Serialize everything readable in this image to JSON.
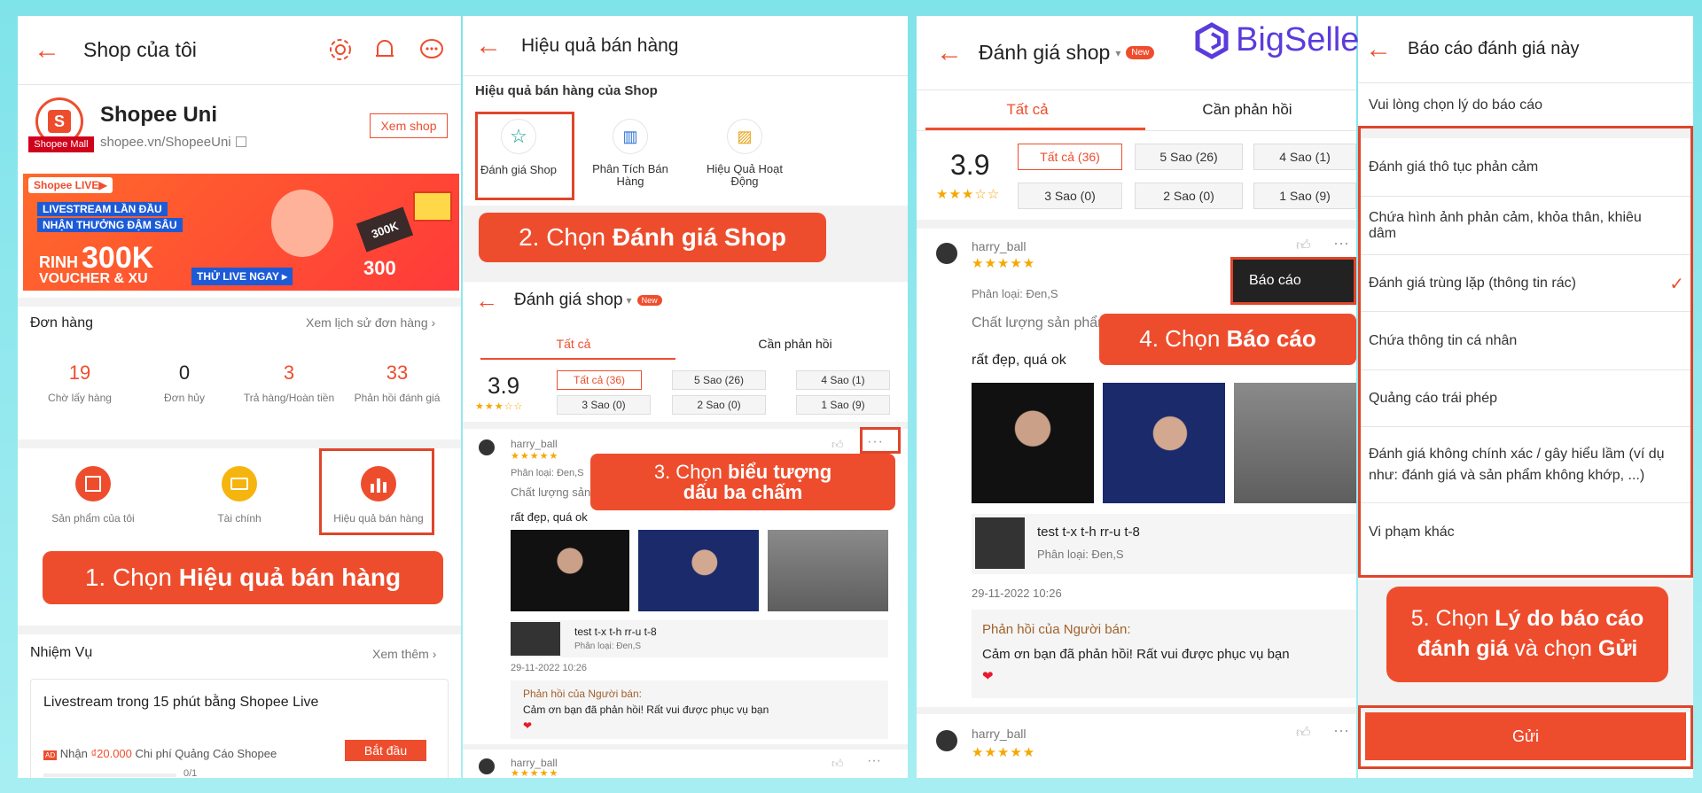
{
  "p1": {
    "title": "Shop của tôi",
    "shop_name": "Shopee Uni",
    "shop_url": "shopee.vn/ShopeeUni",
    "view_shop": "Xem shop",
    "mall_badge": "Shopee Mall",
    "banner": {
      "live_tag": "Shopee LIVE▶",
      "line1": "LIVESTREAM LẦN ĐẦU",
      "line2": "NHẬN THƯỞNG ĐẬM SÂU",
      "line3": "RINH",
      "amount": "300K",
      "line4": "VOUCHER & XU",
      "cta": "THỬ LIVE NGAY ▸",
      "coin1": "300K",
      "coin2": "300"
    },
    "orders": {
      "title": "Đơn hàng",
      "history": "Xem lịch sử đơn hàng",
      "stats": [
        {
          "v": "19",
          "l": "Chờ lấy hàng"
        },
        {
          "v": "0",
          "l": "Đơn hủy"
        },
        {
          "v": "3",
          "l": "Trả hàng/Hoàn tiền"
        },
        {
          "v": "33",
          "l": "Phản hồi đánh giá"
        }
      ]
    },
    "menu": [
      "Sản phẩm của tôi",
      "Tài chính",
      "Hiệu quả bán hàng"
    ],
    "callout_pre": "1. Chọn ",
    "callout_bold": "Hiệu quả bán hàng",
    "tasks": {
      "title": "Nhiệm Vụ",
      "more": "Xem thêm",
      "card_title": "Livestream trong 15 phút bằng Shopee Live",
      "reward_pre": "Nhận ",
      "reward_amt": "₫20.000",
      "reward_post": " Chi phí Quảng Cáo Shopee",
      "start": "Bắt đầu",
      "progress": "0/1"
    }
  },
  "p2": {
    "title": "Hiệu quả bán hàng",
    "section": "Hiệu quả bán hàng của Shop",
    "items": [
      "Đánh giá Shop",
      "Phân Tích Bán Hàng",
      "Hiệu Quả Hoạt Động"
    ],
    "callout_pre": "2. Chọn ",
    "callout_bold": "Đánh giá Shop",
    "review": {
      "title": "Đánh giá shop",
      "new": "New",
      "tab1": "Tất cả",
      "tab2": "Cần phản hồi",
      "rating": "3.9",
      "filters": [
        "Tất cả (36)",
        "5 Sao (26)",
        "4 Sao (1)",
        "3 Sao (0)",
        "2 Sao (0)",
        "1 Sao (9)"
      ],
      "user": "harry_ball",
      "variant": "Phân loại: Đen,S",
      "quality": "Chất lượng sản phẩm",
      "comment": "rất đẹp, quá ok",
      "product": "test t-x t-h rr-u t-8",
      "pvariant": "Phân loại: Đen,S",
      "date": "29-11-2022 10:26",
      "reply_title": "Phản hồi của Người bán:",
      "reply": "Cảm ơn bạn đã phản hồi! Rất vui được phục vụ bạn",
      "user2": "harry_ball"
    },
    "callout3_pre": "3. Chọn ",
    "callout3_bold1": "biểu tượng",
    "callout3_bold2": "dấu ba chấm"
  },
  "p3": {
    "title": "Đánh giá shop",
    "new": "New",
    "tab1": "Tất cả",
    "tab2": "Cần phản hồi",
    "rating": "3.9",
    "filters": [
      "Tất cả (36)",
      "5 Sao (26)",
      "4 Sao (1)",
      "3 Sao (0)",
      "2 Sao (0)",
      "1 Sao (9)"
    ],
    "user": "harry_ball",
    "variant": "Phân loại: Đen,S",
    "quality": "Chất lượng sản phẩm",
    "comment": "rất đẹp, quá ok",
    "report_menu": "Báo cáo",
    "product": "test t-x t-h rr-u t-8",
    "pvariant": "Phân loại: Đen,S",
    "date": "29-11-2022 10:26",
    "reply_title": "Phản hồi của Người bán:",
    "reply": "Cảm ơn bạn đã phản hồi! Rất vui được phục vụ bạn",
    "user2": "harry_ball",
    "callout_pre": "4. Chọn ",
    "callout_bold": "Báo cáo"
  },
  "logo": "BigSeller",
  "p4": {
    "title": "Báo cáo đánh giá này",
    "prompt": "Vui lòng chọn lý do báo cáo",
    "reasons": [
      "Đánh giá thô tục phản cảm",
      "Chứa hình ảnh phản cảm, khỏa thân, khiêu dâm",
      "Đánh giá trùng lặp (thông tin rác)",
      "Chứa thông tin cá nhân",
      "Quảng cáo trái phép",
      "Đánh giá không chính xác / gây hiểu lầm (ví dụ như: đánh giá và sản phẩm không khớp, ...)",
      "Vi phạm khác"
    ],
    "selected_index": 2,
    "callout_l1_pre": "5. Chọn ",
    "callout_l1_bold": "Lý do báo cáo",
    "callout_l2_bold": "đánh giá",
    "callout_l2_mid": " và chọn ",
    "callout_l2_bold2": "Gửi",
    "submit": "Gửi"
  },
  "colors": {
    "accent": "#ee4d2d",
    "bg": "#8fe8ee"
  }
}
